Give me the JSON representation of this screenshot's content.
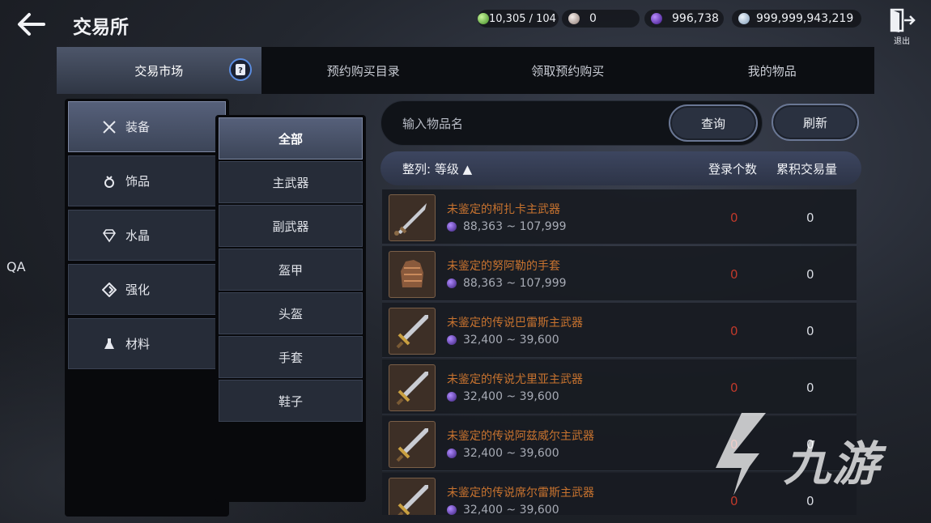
{
  "header": {
    "title": "交易所",
    "exit_label": "退出",
    "currencies": [
      {
        "icon": "energy-gem-icon",
        "value": "10,305 / 104",
        "color": "#7fd35a"
      },
      {
        "icon": "pearl-icon",
        "value": "0",
        "color": "#d8c9c2"
      },
      {
        "icon": "black-pearl-icon",
        "value": "996,738",
        "color": "#7a3cff"
      },
      {
        "icon": "silver-coin-icon",
        "value": "999,999,943,219",
        "color": "#bcd3ea"
      }
    ]
  },
  "tabs": [
    {
      "label": "交易市场",
      "active": true
    },
    {
      "label": "预约购买目录"
    },
    {
      "label": "领取预约购买"
    },
    {
      "label": "我的物品"
    }
  ],
  "side_label": "QA",
  "categories": [
    {
      "label": "装备",
      "icon": "crossed-swords-icon",
      "active": true
    },
    {
      "label": "饰品",
      "icon": "ring-icon"
    },
    {
      "label": "水晶",
      "icon": "diamond-icon"
    },
    {
      "label": "强化",
      "icon": "enhance-icon"
    },
    {
      "label": "材料",
      "icon": "flask-icon"
    }
  ],
  "subcategories": [
    "全部",
    "主武器",
    "副武器",
    "盔甲",
    "头盔",
    "手套",
    "鞋子"
  ],
  "search": {
    "placeholder": "输入物品名",
    "query_label": "查询",
    "refresh_label": "刷新"
  },
  "list_header": {
    "sort_label": "整列: 等级 ▲",
    "count_label": "登录个数",
    "volume_label": "累积交易量"
  },
  "items": [
    {
      "name": "未鉴定的柯扎卡主武器",
      "price": "88,363 ~ 107,999",
      "count": "0",
      "volume": "0",
      "icon": "dagger-icon"
    },
    {
      "name": "未鉴定的努阿勒的手套",
      "price": "88,363 ~ 107,999",
      "count": "0",
      "volume": "0",
      "icon": "gauntlet-icon"
    },
    {
      "name": "未鉴定的传说巴雷斯主武器",
      "price": "32,400 ~ 39,600",
      "count": "0",
      "volume": "0",
      "icon": "sword-icon"
    },
    {
      "name": "未鉴定的传说尤里亚主武器",
      "price": "32,400 ~ 39,600",
      "count": "0",
      "volume": "0",
      "icon": "sword-icon"
    },
    {
      "name": "未鉴定的传说阿兹威尔主武器",
      "price": "32,400 ~ 39,600",
      "count": "0",
      "volume": "0",
      "icon": "sword-icon"
    },
    {
      "name": "未鉴定的传说席尔雷斯主武器",
      "price": "32,400 ~ 39,600",
      "count": "0",
      "volume": "0",
      "icon": "sword-icon"
    }
  ],
  "watermark": "九游"
}
